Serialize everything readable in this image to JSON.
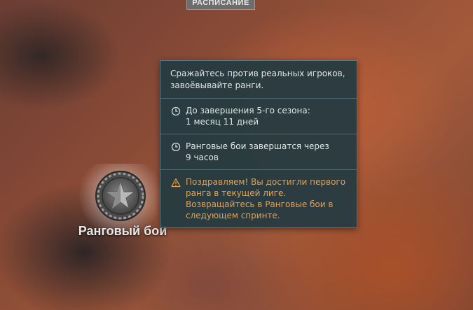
{
  "top_button": {
    "label": "РАСПИСАНИЕ"
  },
  "mode": {
    "label": "Ранговый бой",
    "icon": "ranked-medal-icon"
  },
  "tooltip": {
    "description": "Сражайтесь против реальных игроков, завоёвывайте ранги.",
    "season": {
      "icon": "clock-icon",
      "label": "До завершения 5-го сезона:",
      "value": "1 месяц 11 дней"
    },
    "battles": {
      "icon": "clock-icon",
      "label": "Ранговые бои завершатся через",
      "value": "9 часов"
    },
    "notice": {
      "icon": "warning-icon",
      "text": "Поздравляем! Вы достигли первого ранга в текущей лиге. Возвращайтесь в Ранговые бои в следующем спринте.",
      "color": "#e8a04a"
    }
  }
}
